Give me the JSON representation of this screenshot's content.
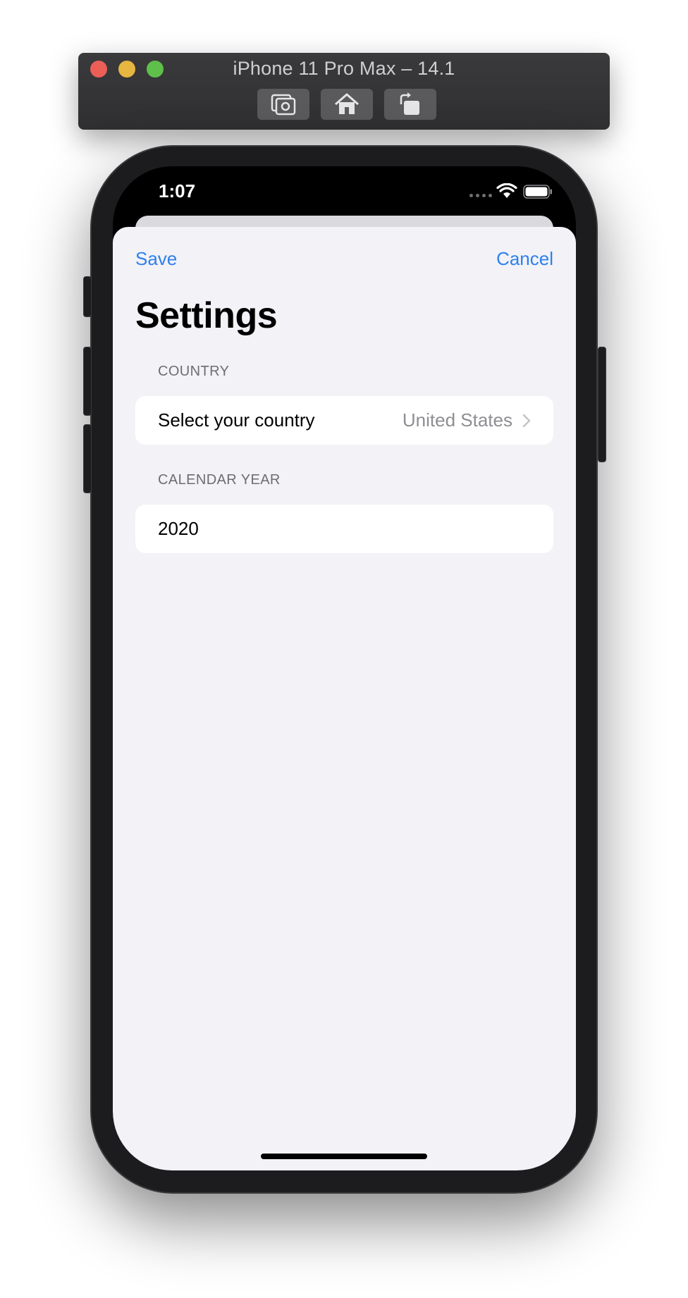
{
  "simulator": {
    "title": "iPhone 11 Pro Max – 14.1",
    "buttons": [
      "screenshot-icon",
      "home-icon",
      "rotate-icon"
    ]
  },
  "status_bar": {
    "time": "1:07"
  },
  "nav": {
    "save_label": "Save",
    "cancel_label": "Cancel",
    "title": "Settings"
  },
  "sections": {
    "country": {
      "header": "COUNTRY",
      "row_label": "Select your country",
      "row_value": "United States"
    },
    "calendar_year": {
      "header": "CALENDAR YEAR",
      "value": "2020"
    }
  },
  "colors": {
    "accent": "#2f80ed",
    "background": "#f2f2f7",
    "secondary_text": "#8e8e93"
  }
}
